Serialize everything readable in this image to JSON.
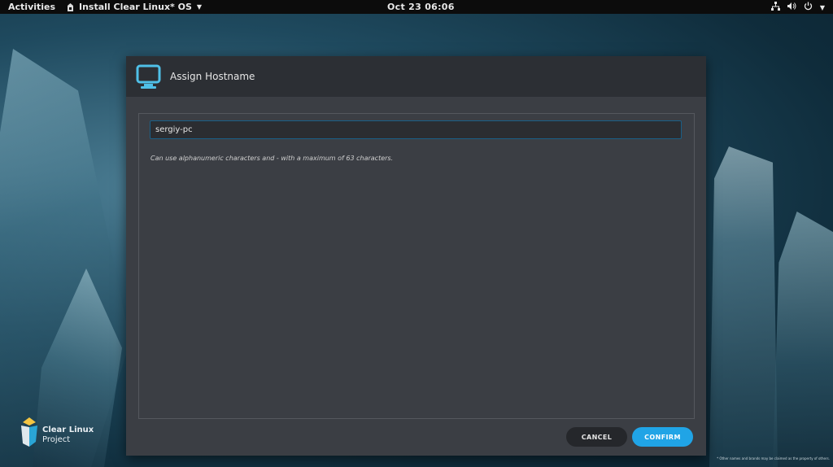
{
  "topbar": {
    "activities": "Activities",
    "app_name": "Install Clear Linux* OS",
    "clock": "Oct 23  06:06"
  },
  "dialog": {
    "title": "Assign Hostname",
    "hostname_value": "sergiy-pc",
    "hint": "Can use alphanumeric characters and - with a maximum of 63 characters.",
    "cancel_label": "CANCEL",
    "confirm_label": "CONFIRM"
  },
  "brand": {
    "line1": "Clear Linux",
    "line2": "Project"
  },
  "footnote": "* Other names and brands may be claimed as the property of others.",
  "colors": {
    "accent": "#20a4e6",
    "dialog_bg": "#3b3e44",
    "header_bg": "#2c2f34",
    "topbar_bg": "#0c0c0c"
  },
  "icons": [
    "app-icon",
    "network-icon",
    "volume-icon",
    "power-icon",
    "monitor-icon",
    "clear-linux-logo-icon"
  ]
}
